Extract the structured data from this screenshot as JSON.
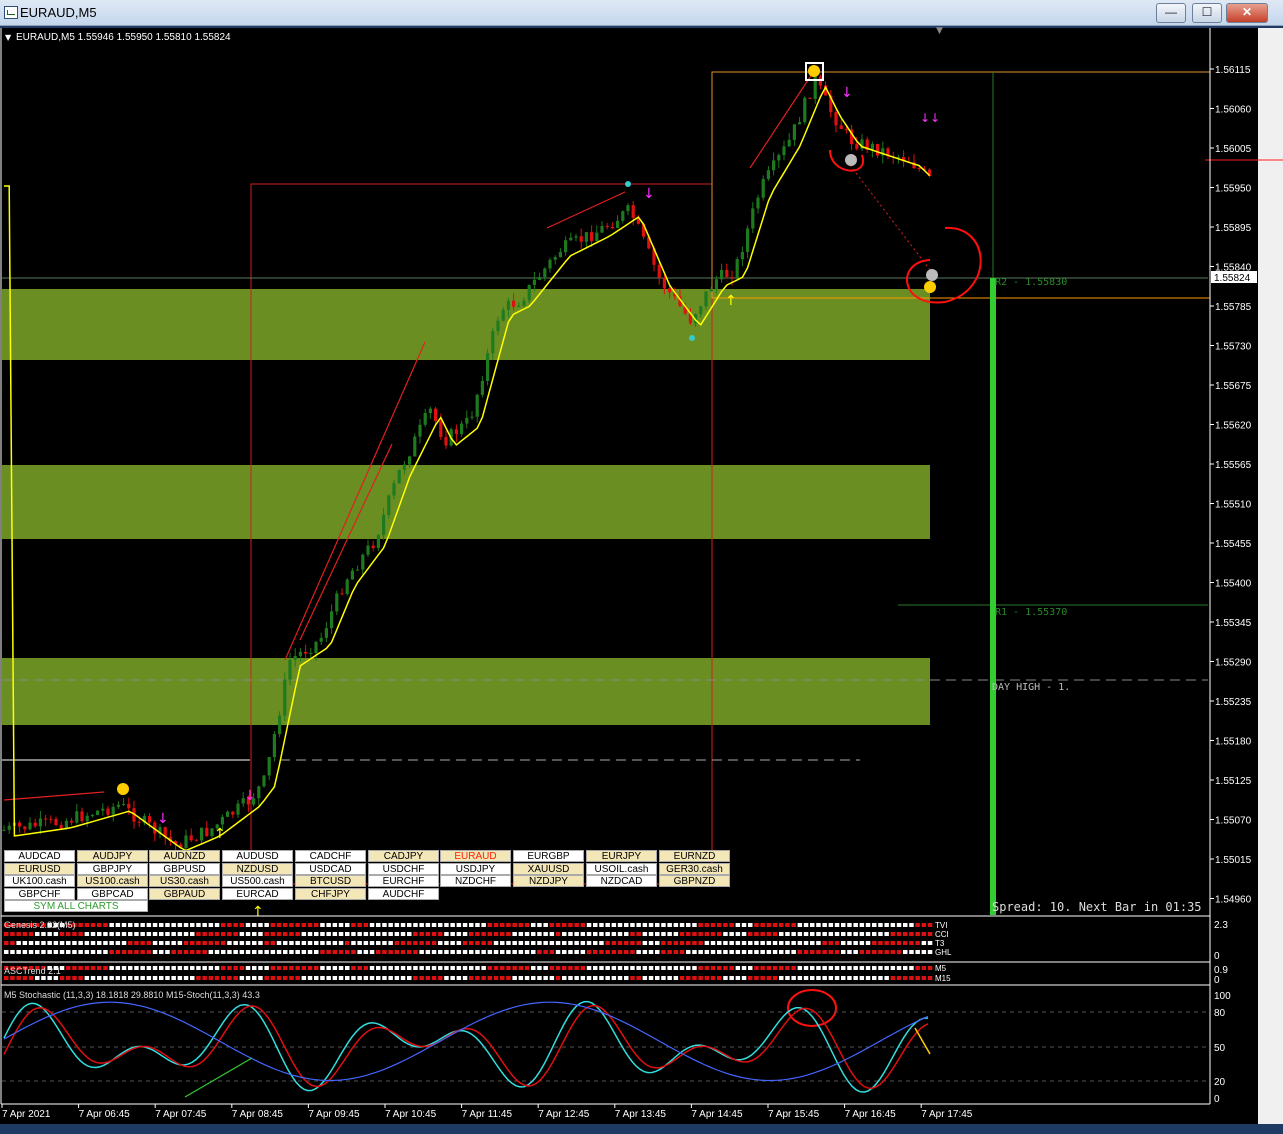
{
  "window": {
    "title": "EURAUD,M5",
    "minimize": "—",
    "maximize": "☐",
    "close": "✕"
  },
  "chart_header": {
    "symbol_line": "EURAUD,M5  1.55946 1.55950 1.55810 1.55824"
  },
  "price_axis": {
    "labels": [
      "1.56115",
      "1.56060",
      "1.56005",
      "1.55950",
      "1.55895",
      "1.55840",
      "1.55785",
      "1.55730",
      "1.55675",
      "1.55620",
      "1.55565",
      "1.55510",
      "1.55455",
      "1.55400",
      "1.55345",
      "1.55290",
      "1.55235",
      "1.55180",
      "1.55125",
      "1.55070",
      "1.55015",
      "1.54960"
    ],
    "current_price": "1.55824"
  },
  "time_axis": {
    "labels": [
      "7 Apr 2021",
      "7 Apr 06:45",
      "7 Apr 07:45",
      "7 Apr 08:45",
      "7 Apr 09:45",
      "7 Apr 10:45",
      "7 Apr 11:45",
      "7 Apr 12:45",
      "7 Apr 13:45",
      "7 Apr 14:45",
      "7 Apr 15:45",
      "7 Apr 16:45",
      "7 Apr 17:45"
    ]
  },
  "annotations": {
    "r2": "R2 - 1.55830",
    "r1": "R1 - 1.55370",
    "day_high": "DAY HIGH - 1.",
    "spread": "Spread: 10. Next Bar in 01:35"
  },
  "symbols": [
    [
      {
        "l": "AUDCAD",
        "s": "w"
      },
      {
        "l": "AUDJPY",
        "s": "y"
      },
      {
        "l": "AUDNZD",
        "s": "y"
      },
      {
        "l": "AUDUSD",
        "s": "w"
      },
      {
        "l": "CADCHF",
        "s": "w"
      },
      {
        "l": "CADJPY",
        "s": "y"
      },
      {
        "l": "EURAUD",
        "s": "y",
        "red": true
      },
      {
        "l": "EURGBP",
        "s": "w"
      },
      {
        "l": "EURJPY",
        "s": "y"
      },
      {
        "l": "EURNZD",
        "s": "y"
      }
    ],
    [
      {
        "l": "EURUSD",
        "s": "y"
      },
      {
        "l": "GBPJPY",
        "s": "w"
      },
      {
        "l": "GBPUSD",
        "s": "w"
      },
      {
        "l": "NZDUSD",
        "s": "y"
      },
      {
        "l": "USDCAD",
        "s": "w"
      },
      {
        "l": "USDCHF",
        "s": "w"
      },
      {
        "l": "USDJPY",
        "s": "w"
      },
      {
        "l": "XAUUSD",
        "s": "y"
      },
      {
        "l": "USOIL.cash",
        "s": "w"
      },
      {
        "l": "GER30.cash",
        "s": "y"
      }
    ],
    [
      {
        "l": "UK100.cash",
        "s": "w"
      },
      {
        "l": "US100.cash",
        "s": "y"
      },
      {
        "l": "US30.cash",
        "s": "y"
      },
      {
        "l": "US500.cash",
        "s": "w"
      },
      {
        "l": "BTCUSD",
        "s": "y"
      },
      {
        "l": "EURCHF",
        "s": "w"
      },
      {
        "l": "NZDCHF",
        "s": "w"
      },
      {
        "l": "NZDJPY",
        "s": "y"
      },
      {
        "l": "NZDCAD",
        "s": "w"
      },
      {
        "l": "GBPNZD",
        "s": "y"
      }
    ],
    [
      {
        "l": "GBPCHF",
        "s": "w"
      },
      {
        "l": "GBPCAD",
        "s": "w"
      },
      {
        "l": "GBPAUD",
        "s": "y"
      },
      {
        "l": "EURCAD",
        "s": "w"
      },
      {
        "l": "CHFJPY",
        "s": "y"
      },
      {
        "l": "AUDCHF",
        "s": "w"
      }
    ]
  ],
  "sym_all": "SYM ALL CHARTS",
  "indicators": {
    "genesis": {
      "title": "Genesis 2.22(M5)",
      "rows": [
        "TVI",
        "CCI",
        "T3",
        "GHL"
      ],
      "scale_top": "2.3",
      "scale_bottom": "0"
    },
    "asctrend": {
      "title": "ASCTrend 2.1",
      "rows": [
        "M5",
        "M15"
      ],
      "scale_top": "0.9",
      "scale_bottom": "0"
    },
    "stoch": {
      "title": "M5 Stochastic (11,3,3) 18.1818 29.8810  M15-Stoch(11,3,3) 43.3",
      "levels": [
        "100",
        "80",
        "50",
        "20",
        "0"
      ]
    }
  },
  "colors": {
    "bull": "#1e7a1e",
    "bear": "#e01010",
    "ma": "#ffff00",
    "zone": "#6b8e23",
    "green_line": "#33cc33"
  }
}
